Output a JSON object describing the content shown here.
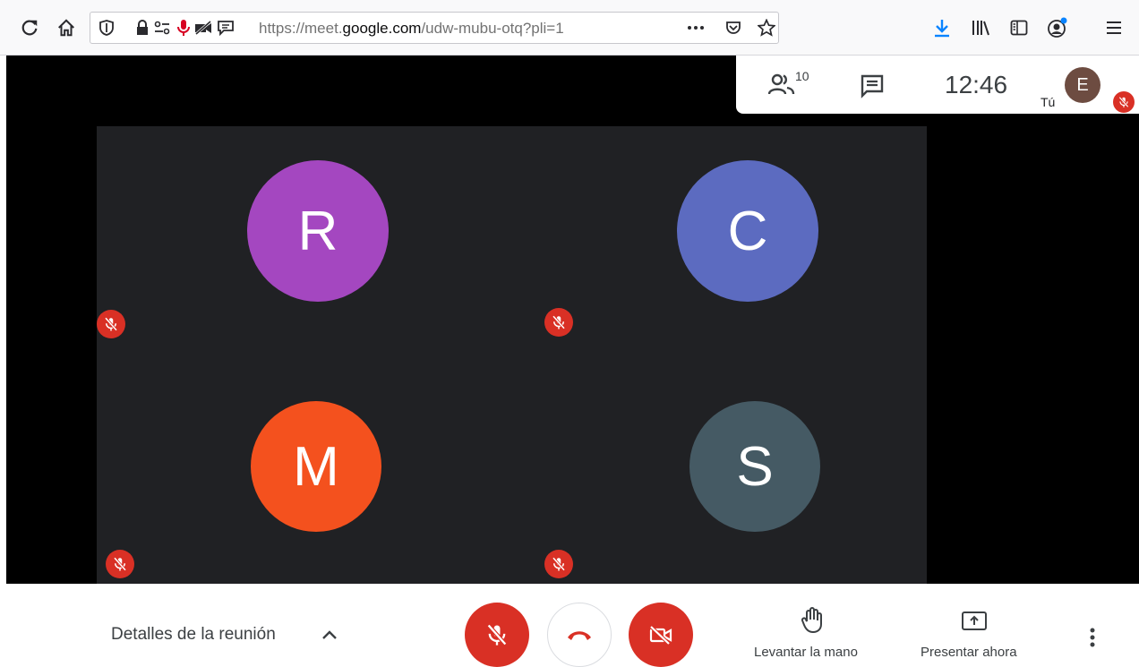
{
  "browser": {
    "url_prefix": "https://meet.",
    "url_domain": "google.com",
    "url_path": "/udw-mubu-otq?pli=1",
    "icons": [
      "reload-icon",
      "home-icon",
      "shield-icon",
      "lock-icon",
      "permissions-icon",
      "microphone-icon",
      "camera-off-icon",
      "chat-permission-icon",
      "more-icon",
      "pocket-icon",
      "star-icon",
      "download-icon",
      "library-icon",
      "sidebar-icon",
      "account-icon",
      "menu-icon"
    ]
  },
  "meeting_info": {
    "participants_count": "10",
    "clock": "12:46",
    "self_initial": "E",
    "self_label": "Tú"
  },
  "participants": [
    {
      "initial": "R",
      "color": "#a447c0"
    },
    {
      "initial": "C",
      "color": "#5c6bc0"
    },
    {
      "initial": "M",
      "color": "#f4511e"
    },
    {
      "initial": "S",
      "color": "#455a64"
    }
  ],
  "colors": {
    "mute_red": "#d93025",
    "self_avatar": "#6d4c41",
    "stage_bg": "#202124"
  },
  "controls": {
    "details_label": "Detalles de la reunión",
    "raise_hand_label": "Levantar la mano",
    "present_label": "Presentar ahora"
  }
}
